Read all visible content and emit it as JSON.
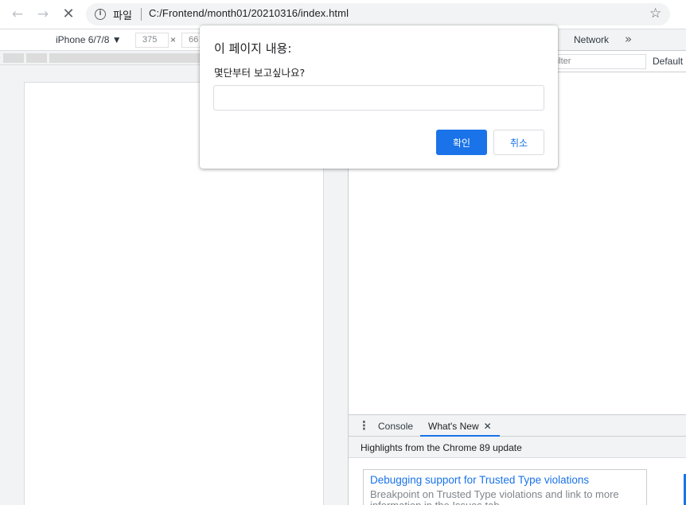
{
  "browser": {
    "back_icon": "←",
    "forward_icon": "→",
    "stop_icon": "✕",
    "info_icon": "i",
    "scheme_label": "파일",
    "url": "C:/Frontend/month01/20210316/index.html",
    "bookmark_icon": "☆"
  },
  "device_toolbar": {
    "device": "iPhone 6/7/8 ▼",
    "width": "375",
    "times": "×",
    "height": "66"
  },
  "devtools": {
    "tab_network": "Network",
    "more_tabs_icon": "»",
    "filter_placeholder": "Filter",
    "levels_label": "Default"
  },
  "drawer": {
    "kebab_icon": "⋮",
    "tab_console": "Console",
    "tab_whats_new": "What's New",
    "close_icon": "✕",
    "header": "Highlights from the Chrome 89 update",
    "card_title": "Debugging support for Trusted Type violations",
    "card_desc": "Breakpoint on Trusted Type violations and link to more information in the Issues tab."
  },
  "dialog": {
    "title": "이 페이지 내용:",
    "message": "몇단부터 보고싶나요?",
    "input_value": "",
    "ok_label": "확인",
    "cancel_label": "취소"
  },
  "colors": {
    "accent": "#1a73e8",
    "text": "#202124",
    "muted": "#80868b"
  }
}
